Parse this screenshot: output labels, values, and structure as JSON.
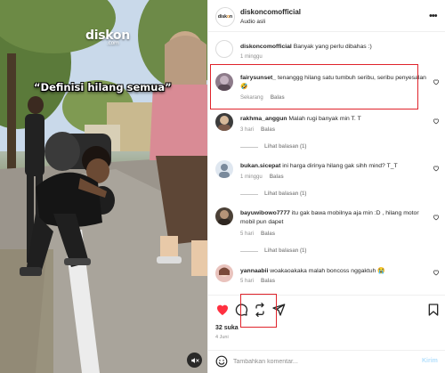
{
  "video": {
    "watermark": "diskon",
    "watermark_sub": ".com",
    "caption": "“Definisi hilang semua”"
  },
  "post": {
    "username": "diskoncomofficial",
    "audio": "Audio asli",
    "brand_avatar_text": "disk",
    "brand_avatar_dot": "o",
    "brand_avatar_text2": "n"
  },
  "caption": {
    "username": "diskoncomofficial",
    "text": "Banyak yang perlu dibahas :)",
    "time": "1 minggu"
  },
  "comments": [
    {
      "username": "fairysunset_",
      "text": "tenanggg hilang satu tumbuh seribu, seribu penyesalan 🤣",
      "time": "Sekarang",
      "reply": "Balas",
      "view_replies": ""
    },
    {
      "username": "rakhma_anggun",
      "text": "Malah rugi banyak min T. T",
      "time": "3 hari",
      "reply": "Balas",
      "view_replies": "Lihat balasan (1)"
    },
    {
      "username": "bukan.sicepat",
      "text": "ini harga dirinya hilang gak sihh mind? T_T",
      "time": "1 minggu",
      "reply": "Balas",
      "view_replies": "Lihat balasan (1)"
    },
    {
      "username": "bayuwibowo7777",
      "text": "itu gak bawa mobilnya aja min :D , hilang motor mobil pun dapet",
      "time": "5 hari",
      "reply": "Balas",
      "view_replies": "Lihat balasan (1)"
    },
    {
      "username": "yannaabii",
      "text": "woakaoakaka malah boncoss nggaktuh 😭",
      "time": "5 hari",
      "reply": "Balas",
      "view_replies": ""
    }
  ],
  "actions": {
    "likes": "32 suka",
    "date": "4 Juni"
  },
  "add_comment": {
    "placeholder": "Tambahkan komentar...",
    "post_label": "Kirim"
  },
  "colors": {
    "like_red": "#ff3040",
    "highlight_red": "#e0232b",
    "muted_text": "#8e8e8e",
    "post_button": "#b2dffc"
  }
}
